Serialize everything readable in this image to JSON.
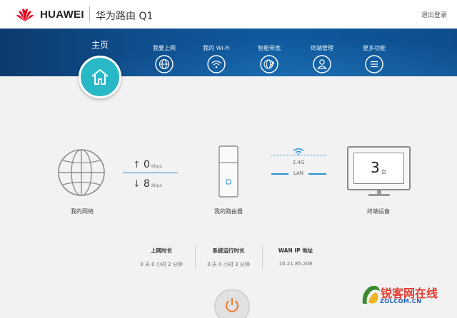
{
  "header": {
    "brand": "HUAWEI",
    "product": "华为路由 Q1",
    "logout_label": "退出登录"
  },
  "nav": {
    "home_label": "主页",
    "items": [
      {
        "label": "我要上网",
        "icon": "globe-icon"
      },
      {
        "label": "我的 Wi-Fi",
        "icon": "wifi-icon"
      },
      {
        "label": "智能带宽",
        "icon": "bandwidth-globe-icon"
      },
      {
        "label": "终端管理",
        "icon": "user-icon"
      },
      {
        "label": "更多功能",
        "icon": "menu-icon"
      }
    ]
  },
  "network": {
    "label": "我的网络",
    "upload_value": "0",
    "upload_unit": "Kbps",
    "download_value": "8",
    "download_unit": "Kbps"
  },
  "router": {
    "label": "我的路由器",
    "band": "2.4G",
    "link_type": "LAN"
  },
  "devices": {
    "count": "3",
    "unit": "台",
    "label": "终端设备"
  },
  "stats": [
    {
      "label": "上网时长",
      "value": "0 天 0 小时 2 分钟"
    },
    {
      "label": "系统运行时长",
      "value": "0 天 0 小时 3 分钟"
    },
    {
      "label": "WAN IP 地址",
      "value": "10.21.85.208"
    }
  ],
  "watermark": {
    "text": "锐客网在线",
    "sub": "ZOLCOM.CN"
  },
  "colors": {
    "nav_band": "#0f4d8c",
    "home_accent": "#28b8c6",
    "link_line": "#2a8fd6",
    "power": "#f07a2a",
    "brand_red": "#e4001b"
  }
}
